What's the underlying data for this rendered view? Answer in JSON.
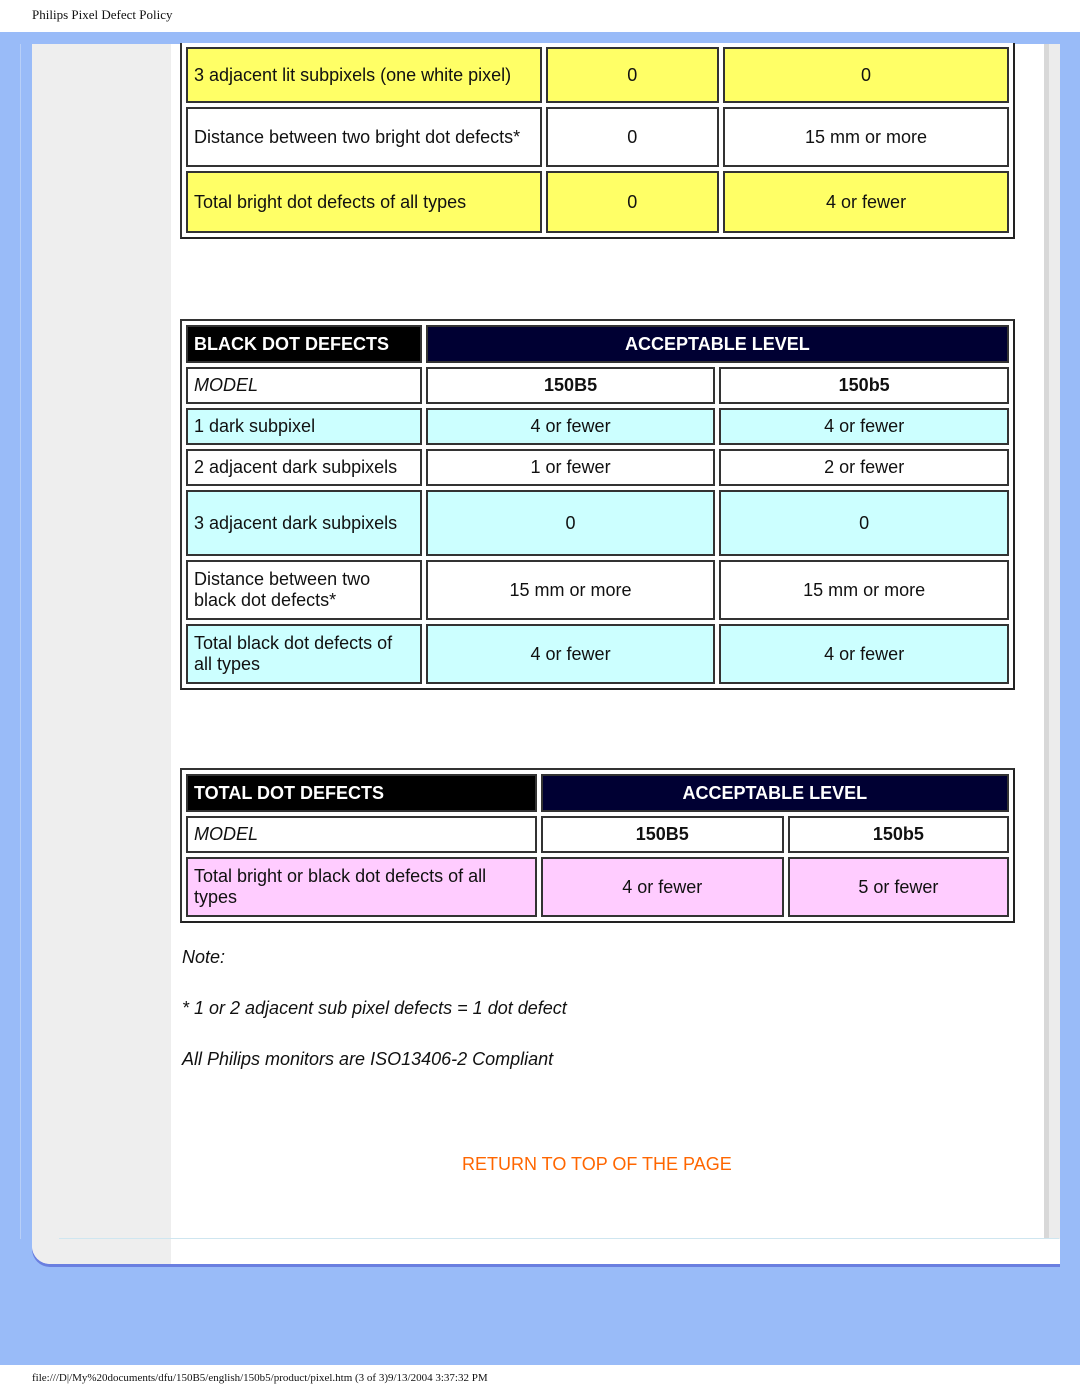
{
  "page": {
    "title": "Philips Pixel Defect Policy",
    "footer": "file:///D|/My%20documents/dfu/150B5/english/150b5/product/pixel.htm (3 of 3)9/13/2004 3:37:32 PM"
  },
  "bright_table": {
    "rows": [
      {
        "label": "3 adjacent lit subpixels (one white pixel)",
        "v1": "0",
        "v2": "0",
        "color": "yellow"
      },
      {
        "label": "Distance between two bright dot defects*",
        "v1": "0",
        "v2": "15 mm or more",
        "color": "white"
      },
      {
        "label": "Total bright dot defects of all types",
        "v1": "0",
        "v2": "4 or fewer",
        "color": "yellow"
      }
    ]
  },
  "black_table": {
    "header": "BLACK DOT DEFECTS",
    "level_header": "ACCEPTABLE LEVEL",
    "model_label": "MODEL",
    "models": [
      "150B5",
      "150b5"
    ],
    "rows": [
      {
        "label": "1 dark subpixel",
        "v1": "4 or fewer",
        "v2": "4 or fewer",
        "color": "cyan"
      },
      {
        "label": "2 adjacent dark subpixels",
        "v1": "1 or fewer",
        "v2": "2 or fewer",
        "color": "white"
      },
      {
        "label": "3 adjacent dark subpixels",
        "v1": "0",
        "v2": "0",
        "color": "cyan"
      },
      {
        "label": "Distance between two black dot defects*",
        "v1": "15 mm or more",
        "v2": "15 mm or more",
        "color": "white"
      },
      {
        "label": "Total black dot defects of all types",
        "v1": "4 or fewer",
        "v2": "4 or fewer",
        "color": "cyan"
      }
    ]
  },
  "total_table": {
    "header": "TOTAL DOT DEFECTS",
    "level_header": "ACCEPTABLE LEVEL",
    "model_label": "MODEL",
    "models": [
      "150B5",
      "150b5"
    ],
    "rows": [
      {
        "label": "Total bright or black dot defects of all types",
        "v1": "4 or fewer",
        "v2": "5 or fewer",
        "color": "pink"
      }
    ]
  },
  "notes": {
    "heading": "Note:",
    "line1": "* 1 or 2 adjacent sub pixel defects = 1 dot defect",
    "line2": "All Philips monitors are ISO13406-2 Compliant"
  },
  "return_link": "RETURN TO TOP OF THE PAGE",
  "colors": {
    "yellow": "#ffff66",
    "cyan": "#ccffff",
    "pink": "#ffccff",
    "navy": "#000033",
    "link": "#ff6600",
    "frame": "#99bbf8"
  }
}
